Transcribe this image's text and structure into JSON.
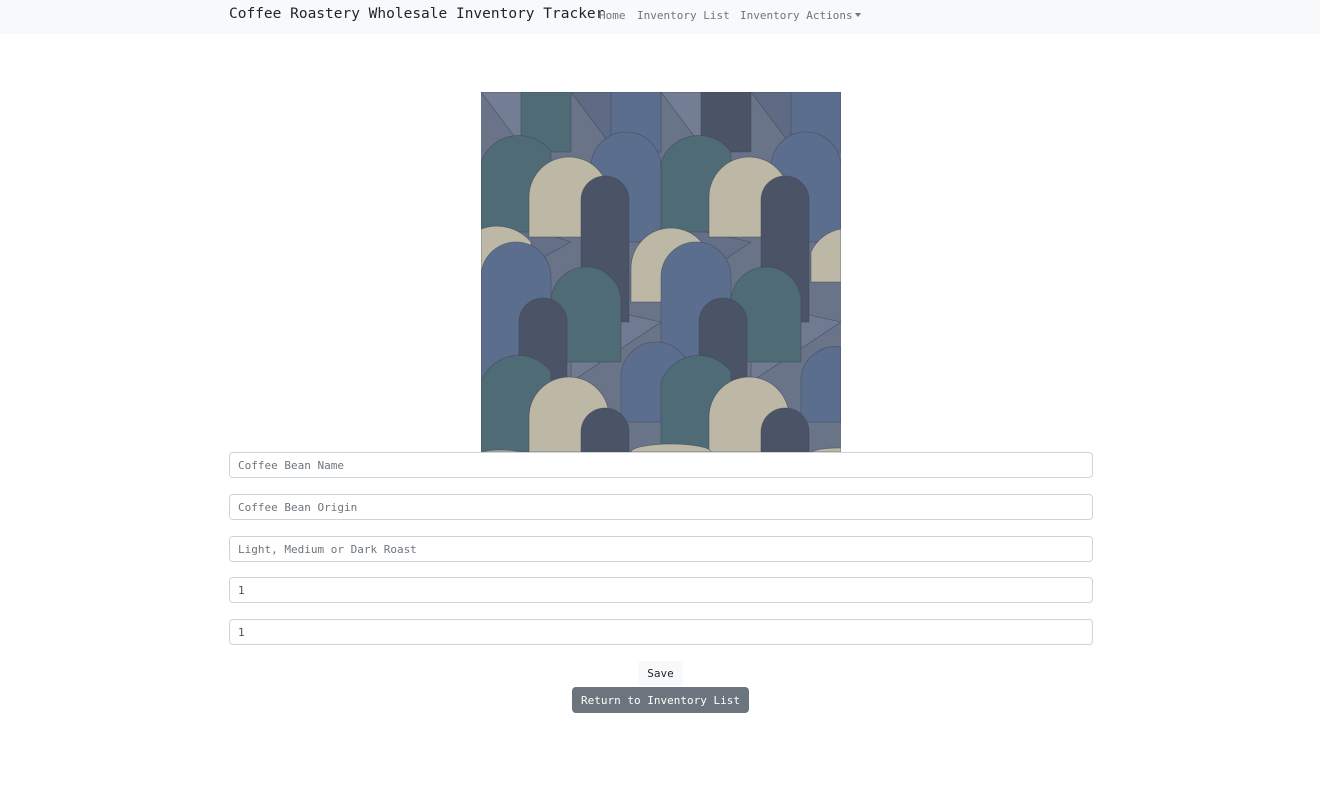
{
  "navbar": {
    "brand": "Coffee Roastery Wholesale Inventory Tracker",
    "links": {
      "home": "Home",
      "inventory_list": "Inventory List",
      "inventory_actions": "Inventory Actions"
    }
  },
  "hero_image": {
    "icon": "abstract-arch-pattern-image",
    "colors": {
      "slate": "#6a7489",
      "blue": "#5c6e8e",
      "teal": "#4f6c76",
      "dark": "#4b5366",
      "cream": "#bdb8a6"
    }
  },
  "form": {
    "name_placeholder": "Coffee Bean Name",
    "origin_placeholder": "Coffee Bean Origin",
    "roast_placeholder": "Light, Medium or Dark Roast",
    "quantity_value": "1",
    "price_value": "1",
    "save_label": "Save",
    "return_label": "Return to Inventory List"
  }
}
